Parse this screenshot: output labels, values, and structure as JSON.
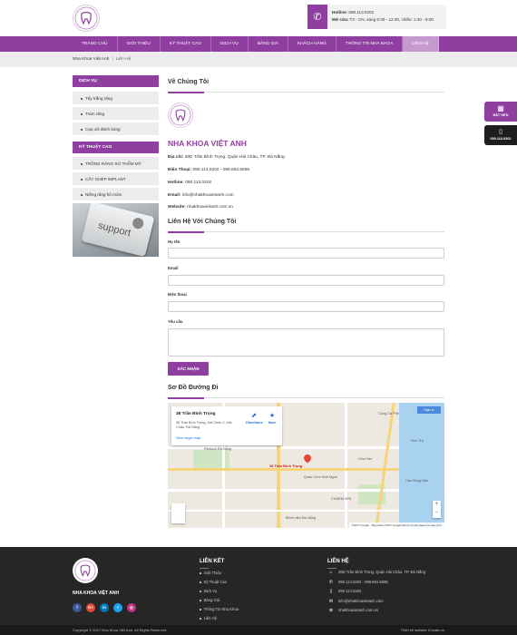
{
  "header": {
    "hotline_label": "Hotline:",
    "hotline_value": "090.113.0202",
    "hours_label": "Mở cửa:",
    "hours_value": "T2 - CN, sáng 8:30 - 12:00, chiều: 1:30 - 8:00"
  },
  "nav": {
    "items": [
      "Trang chủ",
      "Giới thiệu",
      "Kỹ thuật cao",
      "Dịch vụ",
      "Bảng giá",
      "Khách hàng",
      "Thông tin nha khoa",
      "Liên hệ"
    ],
    "active": "Liên hệ"
  },
  "breadcrumb": {
    "home": "Nha Khoa Việt Anh",
    "separator": "|",
    "current": "Liên Hệ"
  },
  "sidebar": {
    "services_title": "Dịch vụ",
    "services": [
      "Tẩy trắng răng",
      "Trám răng",
      "Cạo vôi đánh bóng"
    ],
    "tech_title": "Kỹ thuật cao",
    "tech": [
      "TRỒNG RĂNG SỨ THẨM MỸ",
      "CẤY GHÉP IMPLANT",
      "Niềng răng hô móm"
    ],
    "support_text": "support"
  },
  "about": {
    "title": "Về Chúng Tôi",
    "company": "NHA KHOA VIỆT ANH",
    "address_label": "Địa chỉ:",
    "address": "38D Trần Bình Trọng, Quận Hải Châu, TP. Đà Nẵng",
    "phone_label": "Điện Thoại:",
    "phone": "090.113.0202 - 098.894.6695",
    "hotline_label": "Hotline:",
    "hotline": "090.113.0202",
    "email_label": "Email:",
    "email": "info@nhakhoavietanh.com",
    "website_label": "Website:",
    "website": "nhakhoavietanh.com.vn"
  },
  "contact_form": {
    "title": "Liên Hệ Với Chúng Tôi",
    "name_label": "Họ tên",
    "email_label": "Email",
    "phone_label": "Điện thoại",
    "request_label": "Yêu cầu",
    "submit_label": "Xác nhận"
  },
  "map_section": {
    "title": "Sơ Đồ Đường Đi",
    "place_title": "38 Trần Bình Trọng",
    "place_address": "38 Trần Bình Trọng, Hải Châu 2, Hải Châu, Đà Nẵng",
    "larger_map": "View larger map",
    "directions": "Directions",
    "save": "Save",
    "sign_in": "Sign in",
    "pin_label": "38 Trần Bình Trọng",
    "labels": [
      "Cộng Cà Phê",
      "Parkson Đà Nẵng",
      "Quán Cơm Huế Ngon",
      "CHARM SPA",
      "Sơn Trà",
      "Chợ Hàn",
      "Cầu Sông Hàn",
      "Bệnh viện Đà Nẵng"
    ],
    "zoom_in": "+",
    "zoom_out": "−",
    "attribution": "©2017 Google · Map data ©2017 Google   Terms of Use   Report a map error"
  },
  "floating": {
    "book_label": "ĐẶT HẸN",
    "phone_label": "090.113.0202"
  },
  "footer": {
    "brand": "NHA KHOA VIỆT ANH",
    "social": [
      {
        "name": "facebook-icon",
        "glyph": "f",
        "color": "#3b5998"
      },
      {
        "name": "google-plus-icon",
        "glyph": "G+",
        "color": "#dd4b39"
      },
      {
        "name": "linkedin-icon",
        "glyph": "in",
        "color": "#0077b5"
      },
      {
        "name": "twitter-icon",
        "glyph": "t",
        "color": "#1da1f2"
      },
      {
        "name": "instagram-icon",
        "glyph": "◎",
        "color": "#c13584"
      }
    ],
    "links_title": "Liên kết",
    "links": [
      "Giới Thiệu",
      "Kỹ Thuật Cao",
      "Dịch Vụ",
      "Bảng Giá",
      "Thông Tin Nha Khoa",
      "Liên Hệ"
    ],
    "contact_title": "Liên hệ",
    "contact": [
      {
        "icon": "home-icon",
        "glyph": "⌂",
        "text": "38D Trần Bình Trọng, Quận Hải Châu, TP. Đà Nẵng"
      },
      {
        "icon": "phone-icon",
        "glyph": "✆",
        "text": "090.113.0202 - 098.894.6695"
      },
      {
        "icon": "mobile-icon",
        "glyph": "▯",
        "text": "090.113.0202"
      },
      {
        "icon": "mail-icon",
        "glyph": "✉",
        "text": "info@nhakhoavietanh.com"
      },
      {
        "icon": "globe-icon",
        "glyph": "⊕",
        "text": "nhakhoavietanh.com.vn"
      }
    ],
    "copyright": "Copyright © 2017 Nha Khoa Việt Anh. All Rights Reserved.",
    "designer": "Thiết kế website iCreate.vn"
  },
  "colors": {
    "brand": "#8e3fa0",
    "footer": "#262626"
  }
}
